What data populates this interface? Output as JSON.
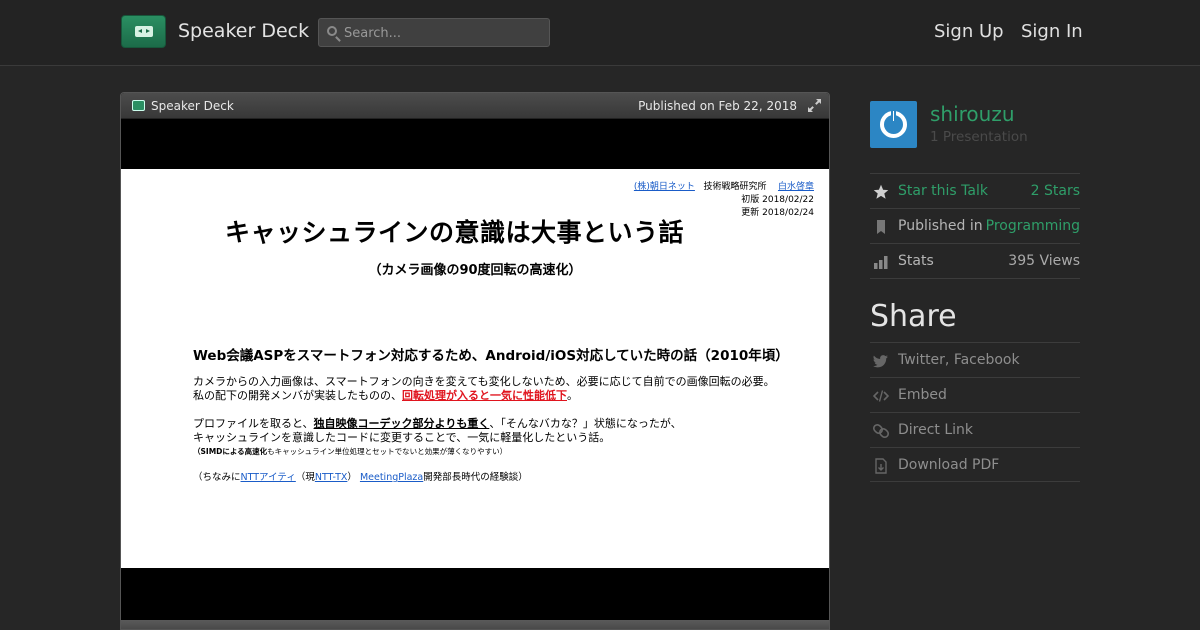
{
  "header": {
    "brand": "Speaker Deck",
    "search_placeholder": "Search...",
    "sign_up": "Sign Up",
    "sign_in": "Sign In"
  },
  "player": {
    "brand": "Speaker Deck",
    "published": "Published on Feb 22, 2018"
  },
  "slide": {
    "affiliation_company": "(株)朝日ネット",
    "affiliation_dept": "技術戦略研究所",
    "affiliation_author": "白水啓章",
    "first_edition": "初版 2018/02/22",
    "updated": "更新 2018/02/24",
    "title": "キャッシュラインの意識は大事という話",
    "subtitle": "（カメラ画像の90度回転の高速化）",
    "heading": "Web会議ASPをスマートフォン対応するため、Android/iOS対応していた時の話（2010年頃）",
    "para1_line1": "カメラからの入力画像は、スマートフォンの向きを変えても変化しないため、必要に応じて自前での画像回転の必要。",
    "para1_line2_pre": "私の配下の開発メンバが実装したものの、",
    "para1_line2_red": "回転処理が入ると一気に性能低下",
    "para1_line2_post": "。",
    "para2_line1_pre": "プロファイルを取ると、",
    "para2_line1_bold": "独自映像コーデック部分よりも重く",
    "para2_line1_post": "、「そんなバカな？」状態になったが、",
    "para2_line2": "キャッシュラインを意識したコードに変更することで、一気に軽量化したという話。",
    "note_bold": "（SIMDによる高速化",
    "note_rest": "もキャッシュライン単位処理とセットでないと効果が薄くなりやすい）",
    "footer_pre": "（ちなみに",
    "footer_link1": "NTTアイティ",
    "footer_mid1": "（現",
    "footer_link2": "NTT-TX",
    "footer_mid2": "）",
    "footer_link3": "MeetingPlaza",
    "footer_post": "開発部長時代の経験談）"
  },
  "sidebar": {
    "user_name": "shirouzu",
    "presentation_count": "1 Presentation",
    "star_label": "Star this Talk",
    "star_value": "2 Stars",
    "published_label": "Published in",
    "published_value": "Programming",
    "stats_label": "Stats",
    "stats_value": "395 Views",
    "share_title": "Share",
    "share_social": "Twitter, Facebook",
    "embed": "Embed",
    "direct_link": "Direct Link",
    "download_pdf": "Download PDF"
  },
  "colors": {
    "accent_green": "#2f9e69",
    "avatar_blue": "#2c86c4",
    "background": "#262626",
    "slide_red": "#e0141e",
    "link_blue": "#1a5cc8"
  }
}
